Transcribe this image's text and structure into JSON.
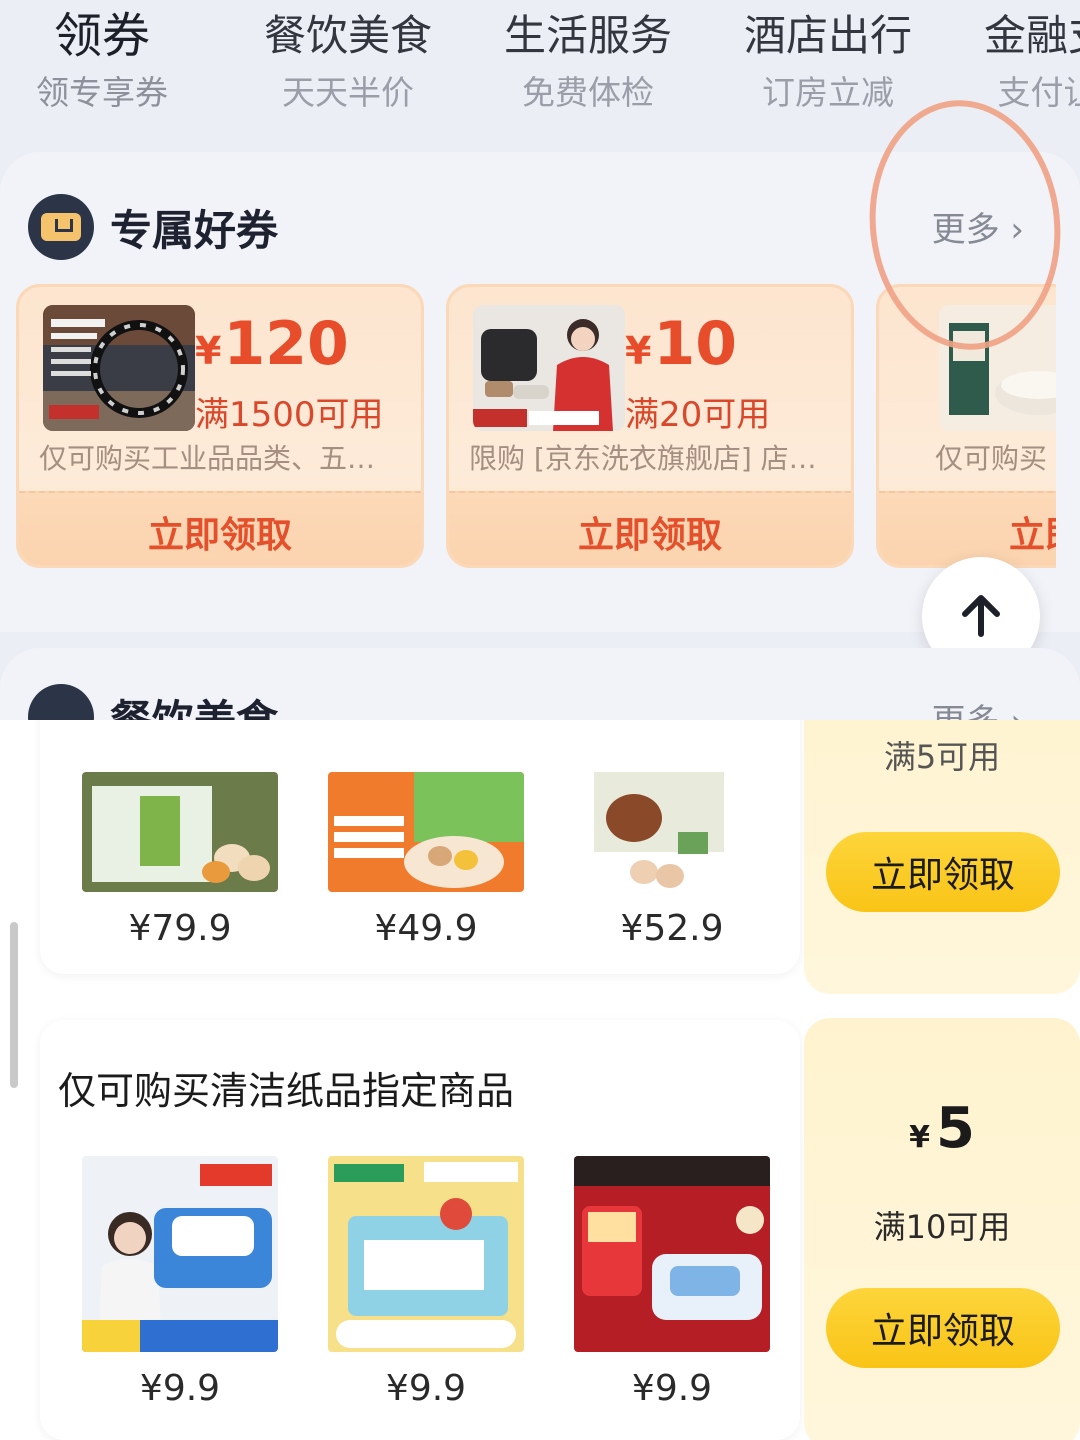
{
  "category_tabs": [
    {
      "title": "领券",
      "subtitle": "领专享券"
    },
    {
      "title": "餐饮美食",
      "subtitle": "天天半价"
    },
    {
      "title": "生活服务",
      "subtitle": "免费体检"
    },
    {
      "title": "酒店出行",
      "subtitle": "订房立减"
    },
    {
      "title": "金融支",
      "subtitle": "支付让"
    }
  ],
  "exclusive_section": {
    "title": "专属好券",
    "more_label": "更多 ›",
    "cards": [
      {
        "currency": "¥",
        "amount": "120",
        "condition": "满1500可用",
        "description": "仅可购买工业品品类、五…",
        "claim_label": "立即领取",
        "thumb": "bracelet-product-image"
      },
      {
        "currency": "¥",
        "amount": "10",
        "condition": "满20可用",
        "description": "限购 [京东洗衣旗舰店] 店…",
        "claim_label": "立即领取",
        "thumb": "laundry-service-image"
      },
      {
        "currency": "¥",
        "amount": "",
        "condition": "",
        "description": "仅可购买",
        "claim_label": "立即",
        "thumb": "milk-powder-image"
      }
    ]
  },
  "food_section": {
    "title": "餐饮美食",
    "more_label": "更多 ›"
  },
  "bottom_rows": [
    {
      "title": "满5可用",
      "products": [
        {
          "price": "¥79.9",
          "image": "eggs-box-image"
        },
        {
          "price": "¥49.9",
          "image": "selenium-eggs-image"
        },
        {
          "price": "¥52.9",
          "image": "eggs-hen-image"
        }
      ],
      "side": {
        "condition": "",
        "claim_label": "立即领取"
      }
    },
    {
      "title": "仅可购买清洁纸品指定商品",
      "products": [
        {
          "price": "¥9.9",
          "image": "wet-wipes-image"
        },
        {
          "price": "¥9.9",
          "image": "tissue-pack-image"
        },
        {
          "price": "¥9.9",
          "image": "cleansing-wipes-image"
        }
      ],
      "side": {
        "currency": "¥",
        "amount": "5",
        "condition": "满10可用",
        "claim_label": "立即领取"
      }
    }
  ],
  "colors": {
    "coupon_red": "#e74d2b",
    "claim_yellow": "#f9c416",
    "annotation": "#f0a184"
  },
  "icons": {
    "back_to_top": "arrow-up-icon",
    "section_logo": "coupon-ticket-icon"
  }
}
